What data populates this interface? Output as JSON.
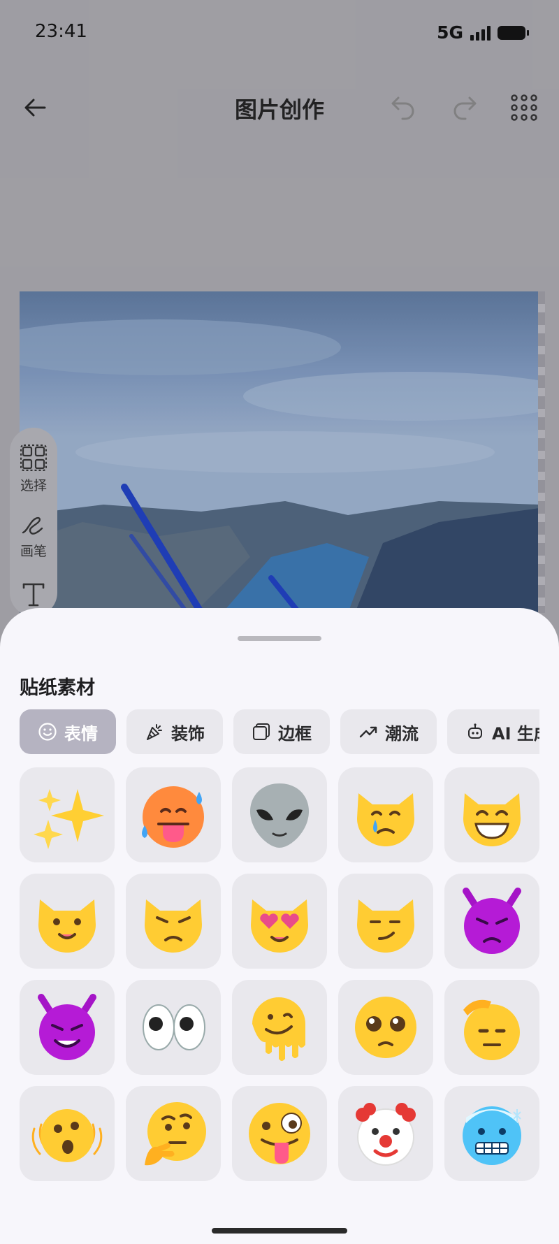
{
  "status": {
    "time": "23:41",
    "network": "5G"
  },
  "header": {
    "title": "图片创作",
    "back_icon": "arrow-left-icon",
    "undo_icon": "undo-icon",
    "redo_icon": "redo-icon",
    "more_icon": "grid-dots-icon"
  },
  "tools": [
    {
      "label": "选择",
      "icon": "select-icon"
    },
    {
      "label": "画笔",
      "icon": "pen-icon"
    },
    {
      "label": "",
      "icon": "text-icon"
    }
  ],
  "sheet": {
    "title": "贴纸素材",
    "tabs": [
      {
        "label": "表情",
        "icon": "smile-icon",
        "active": true
      },
      {
        "label": "装饰",
        "icon": "confetti-icon",
        "active": false
      },
      {
        "label": "边框",
        "icon": "frame-icon",
        "active": false
      },
      {
        "label": "潮流",
        "icon": "trend-icon",
        "active": false
      },
      {
        "label": "AI 生成贴纸",
        "icon": "robot-icon",
        "active": false
      }
    ],
    "stickers": [
      "sparkles",
      "hot-face",
      "alien",
      "crying-cat",
      "grinning-cat",
      "smiling-cat",
      "pouting-cat",
      "heart-eyes-cat",
      "smirk-cat",
      "angry-devil",
      "smiling-devil",
      "eyes",
      "melting-face",
      "pleading-face",
      "saluting-face",
      "shaking-face",
      "thinking-face",
      "zany-face",
      "clown-face",
      "cold-face"
    ]
  },
  "colors": {
    "accent_chip": "#b5b3c1",
    "emoji_yellow": "#ffcc33",
    "devil_purple": "#b51bd6"
  }
}
